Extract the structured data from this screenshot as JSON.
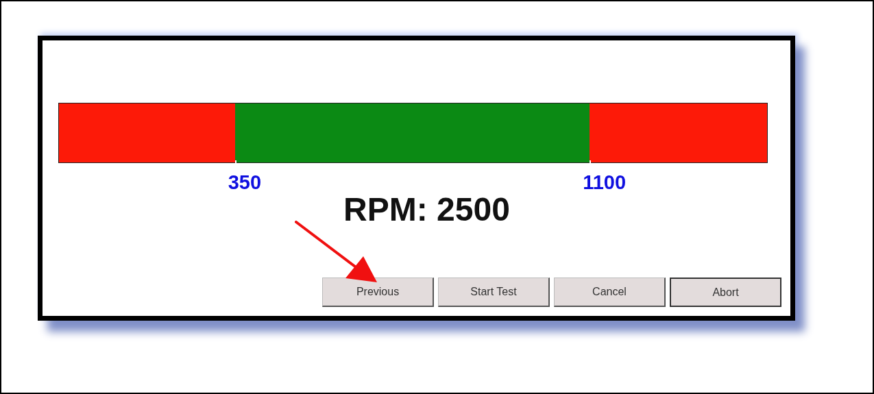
{
  "gauge": {
    "segments": [
      {
        "color": "#fd1a08"
      },
      {
        "color": "#0b8a14"
      },
      {
        "color": "#fd1a08"
      }
    ],
    "markers": [
      {
        "label": "350",
        "level": 0.249
      },
      {
        "label": "1100",
        "level": 0.749
      }
    ]
  },
  "reading": "RPM: 2500",
  "buttons": [
    {
      "label": "Previous",
      "focused": false
    },
    {
      "label": "Start Test",
      "focused": false
    },
    {
      "label": "Cancel",
      "focused": false
    },
    {
      "label": "Abort",
      "focused": true
    }
  ]
}
